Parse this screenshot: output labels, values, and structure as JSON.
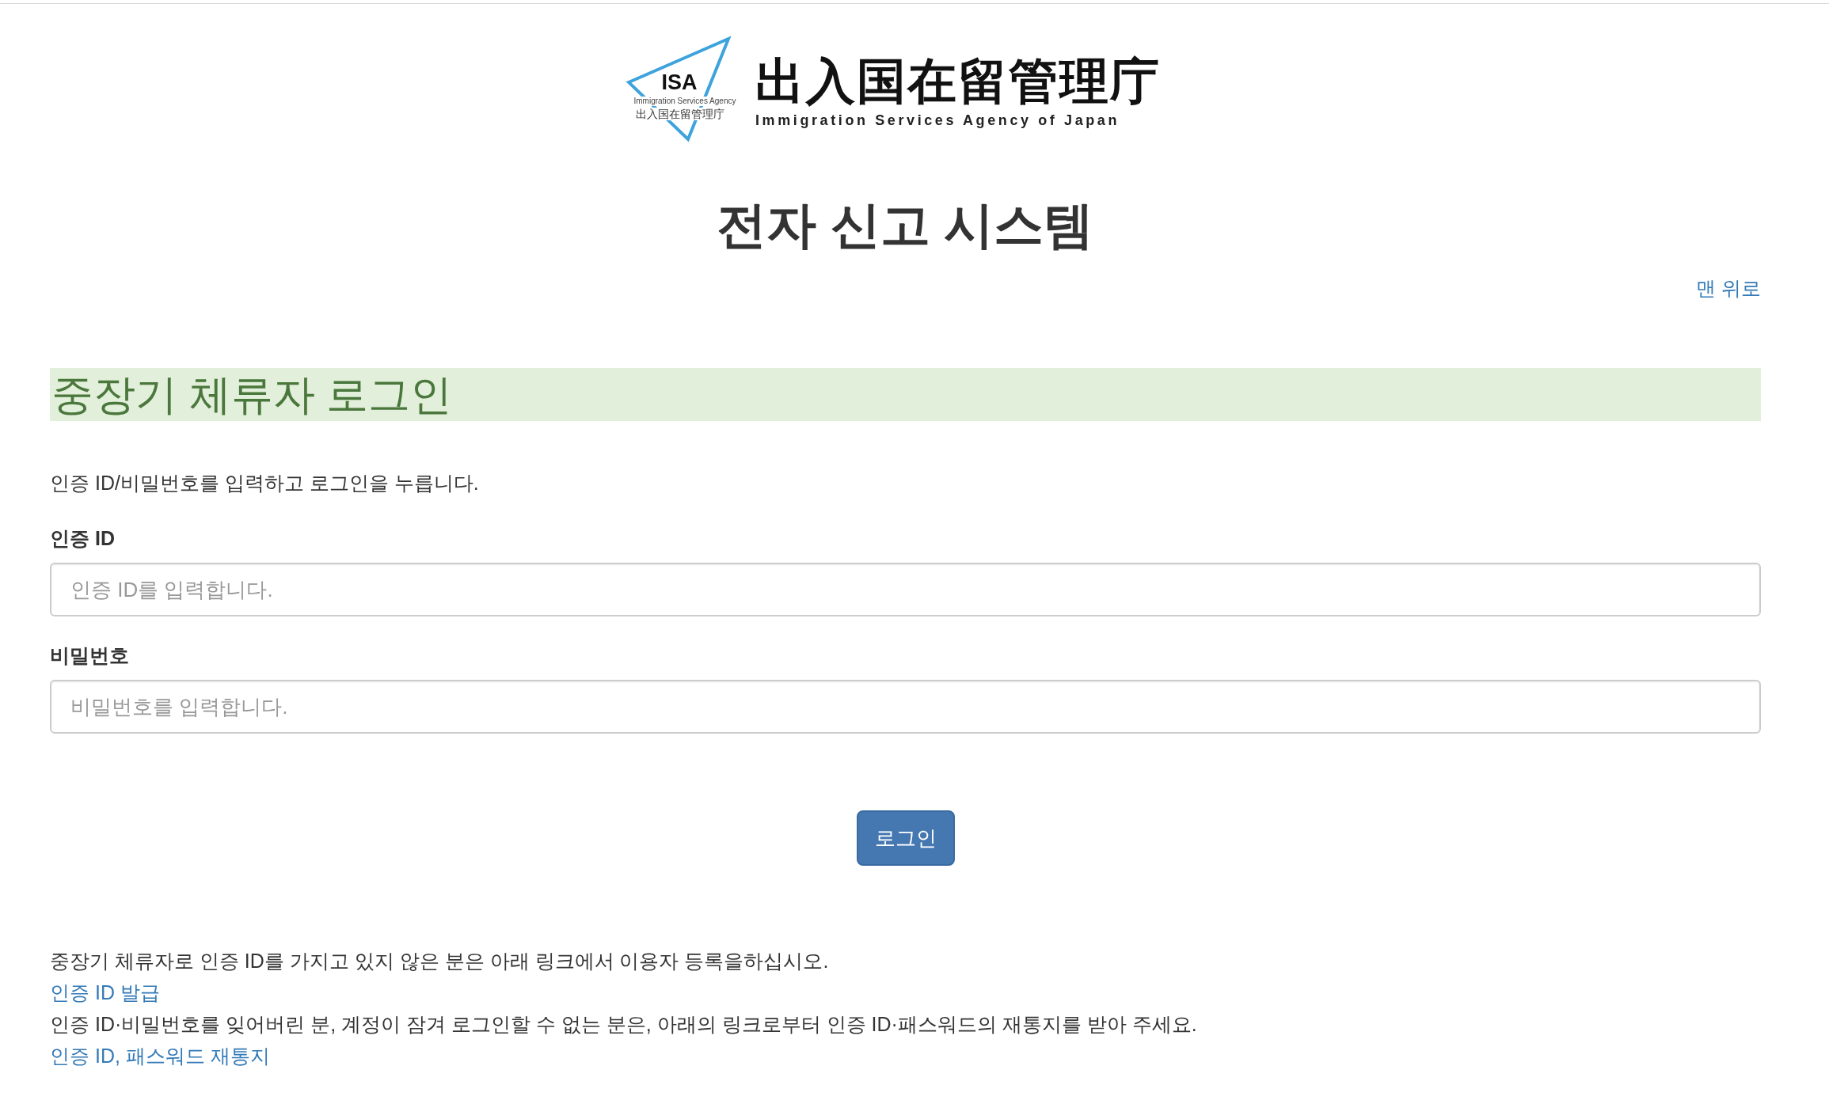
{
  "header": {
    "logo": {
      "emblem_text": "ISA",
      "emblem_subtitle": "Immigration Services Agency",
      "emblem_japanese": "出入国在留管理庁",
      "name": "出入国在留管理庁",
      "name_english": "Immigration Services Agency of Japan"
    },
    "title": "전자 신고 시스템",
    "top_link": "맨 위로"
  },
  "login": {
    "heading": "중장기 체류자 로그인",
    "instructions": "인증 ID/비밀번호를 입력하고 로그인을 누릅니다.",
    "fields": [
      {
        "label": "인증 ID",
        "placeholder": "인증 ID를 입력합니다."
      },
      {
        "label": "비밀번호",
        "placeholder": "비밀번호를 입력합니다."
      }
    ],
    "button": "로그인"
  },
  "help": [
    {
      "kind": "text",
      "text": "중장기 체류자로 인증 ID를 가지고 있지 않은 분은 아래 링크에서 이용자 등록을하십시오."
    },
    {
      "kind": "link",
      "text": "인증 ID 발급"
    },
    {
      "kind": "text",
      "text": "인증 ID·비밀번호를 잊어버린 분, 계정이 잠겨 로그인할 수 없는 분은, 아래의 링크로부터 인증 ID·패스워드의 재통지를 받아 주세요."
    },
    {
      "kind": "link",
      "text": "인증 ID, 패스워드 재통지"
    }
  ]
}
